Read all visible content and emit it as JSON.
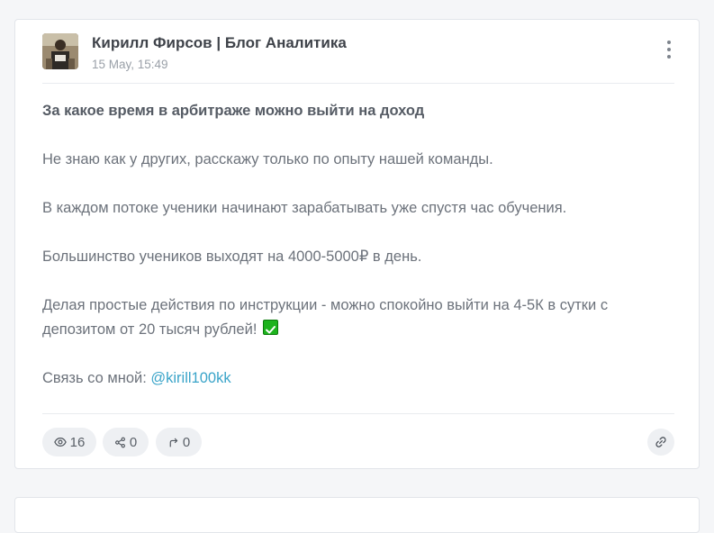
{
  "post": {
    "author": "Кирилл Фирсов | Блог Аналитика",
    "date": "15 May, 15:49",
    "title": "За какое время в арбитраже можно выйти на доход",
    "paragraphs": [
      "Не знаю как у других, расскажу только по опыту нашей команды.",
      "В каждом потоке ученики начинают зарабатывать уже спустя час обучения.",
      "Большинство учеников выходят на 4000-5000₽ в день.",
      "Делая простые действия по инструкции - можно спокойно выйти на 4-5К в сутки с депозитом от 20 тысяч рублей!"
    ],
    "contact_label": "Связь со мной: ",
    "contact_link": "@kirill100kk"
  },
  "footer": {
    "views": "16",
    "shares": "0",
    "forwards": "0"
  },
  "icons": {
    "views": "eye-icon",
    "shares": "share-nodes-icon",
    "forwards": "forward-arrow-icon",
    "link": "link-icon",
    "menu": "more-vertical-icon",
    "check": "check-mark-emoji-icon"
  },
  "colors": {
    "link": "#3aa4c9",
    "check": "#1db31d"
  }
}
